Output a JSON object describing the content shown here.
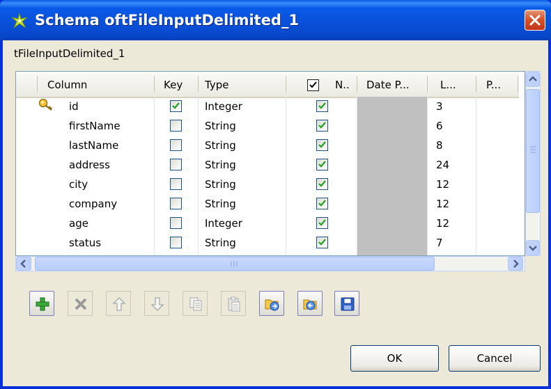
{
  "window": {
    "title": "Schema oftFileInputDelimited_1",
    "subtitle": "tFileInputDelimited_1"
  },
  "table": {
    "headers": {
      "column": "Column",
      "key": "Key",
      "type": "Type",
      "nullable": "N..",
      "date_pattern": "Date P...",
      "length": "L...",
      "precision": "P..."
    },
    "header_checkbox_checked": true,
    "rows": [
      {
        "column": "id",
        "key": true,
        "type": "Integer",
        "nullable": true,
        "length": "3",
        "key_icon": "key-icon"
      },
      {
        "column": "firstName",
        "key": false,
        "type": "String",
        "nullable": true,
        "length": "6"
      },
      {
        "column": "lastName",
        "key": false,
        "type": "String",
        "nullable": true,
        "length": "8"
      },
      {
        "column": "address",
        "key": false,
        "type": "String",
        "nullable": true,
        "length": "24"
      },
      {
        "column": "city",
        "key": false,
        "type": "String",
        "nullable": true,
        "length": "12"
      },
      {
        "column": "company",
        "key": false,
        "type": "String",
        "nullable": true,
        "length": "12"
      },
      {
        "column": "age",
        "key": false,
        "type": "Integer",
        "nullable": true,
        "length": "12"
      },
      {
        "column": "status",
        "key": false,
        "type": "String",
        "nullable": true,
        "length": "7"
      }
    ]
  },
  "toolbar": [
    {
      "name": "add-button",
      "icon": "plus-icon",
      "enabled": true
    },
    {
      "name": "remove-button",
      "icon": "delete-icon",
      "enabled": false
    },
    {
      "name": "move-up-button",
      "icon": "arrow-up-icon",
      "enabled": false
    },
    {
      "name": "move-down-button",
      "icon": "arrow-down-icon",
      "enabled": false
    },
    {
      "name": "copy-button",
      "icon": "copy-icon",
      "enabled": false
    },
    {
      "name": "paste-button",
      "icon": "paste-icon",
      "enabled": false
    },
    {
      "name": "import-button",
      "icon": "import-icon",
      "enabled": true
    },
    {
      "name": "export-button",
      "icon": "export-icon",
      "enabled": true
    },
    {
      "name": "save-button",
      "icon": "save-icon",
      "enabled": true
    }
  ],
  "buttons": {
    "ok_label": "OK",
    "cancel_label": "Cancel"
  },
  "colors": {
    "title_bar": "#0a5ae8",
    "close": "#d4532b",
    "dialog_bg": "#ece9d8",
    "checkmark": "#21a121",
    "date_cell": "#c0c0c0",
    "scroll": "#c4d4fc"
  }
}
